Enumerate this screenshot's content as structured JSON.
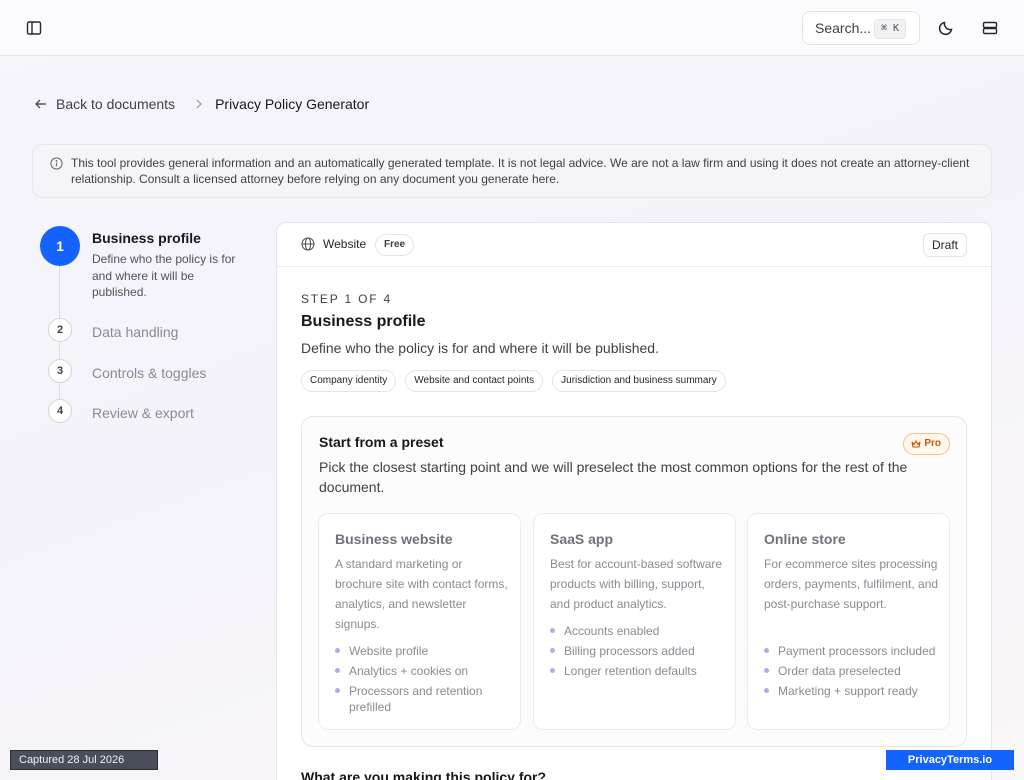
{
  "topbar": {
    "sidebar_toggle_icon": "sidebar-panel-icon",
    "search_placeholder": "Search...",
    "search_shortcut": "⌘ K",
    "theme_icon": "moon-icon",
    "menu_icon": "stacked-panels-icon"
  },
  "breadcrumb": {
    "back_label": "Back to documents",
    "current": "Privacy Policy Generator"
  },
  "notice": {
    "text": "This tool provides general information and an automatically generated template. It is not legal advice. We are not a law firm and using it does not create an attorney-client relationship. Consult a licensed attorney before relying on any document you generate here."
  },
  "steps": [
    {
      "number": "1",
      "title": "Business profile",
      "description": "Define who the policy is for and where it will be published.",
      "active": true
    },
    {
      "number": "2",
      "title": "Data handling"
    },
    {
      "number": "3",
      "title": "Controls & toggles"
    },
    {
      "number": "4",
      "title": "Review & export"
    }
  ],
  "card": {
    "site_type": "Website",
    "plan_badge": "Free",
    "status": "Draft",
    "eyebrow": "STEP 1 OF 4",
    "title": "Business profile",
    "subtitle": "Define who the policy is for and where it will be published.",
    "chips": [
      "Company identity",
      "Website and contact points",
      "Jurisdiction and business summary"
    ],
    "preset": {
      "title": "Start from a preset",
      "badge": "Pro",
      "subtitle": "Pick the closest starting point and we will preselect the most common options for the rest of the document.",
      "options": [
        {
          "title": "Business website",
          "description": "A standard marketing or brochure site with contact forms, analytics, and newsletter signups.",
          "features": [
            "Website profile",
            "Analytics + cookies on",
            "Processors and retention prefilled"
          ]
        },
        {
          "title": "SaaS app",
          "description": "Best for account-based software products with billing, support, and product analytics.",
          "features": [
            "Accounts enabled",
            "Billing processors added",
            "Longer retention defaults"
          ]
        },
        {
          "title": "Online store",
          "description": "For ecommerce sites processing orders, payments, fulfilment, and post-purchase support.",
          "features": [
            "Payment processors included",
            "Order data preselected",
            "Marketing + support ready"
          ]
        }
      ]
    },
    "question": "What are you making this policy for?"
  },
  "footer": {
    "captured": "Captured 28 Jul 2026",
    "brand": "PrivacyTerms.io"
  },
  "colors": {
    "accent": "#1463ff",
    "pro_badge": "#c2580c"
  }
}
